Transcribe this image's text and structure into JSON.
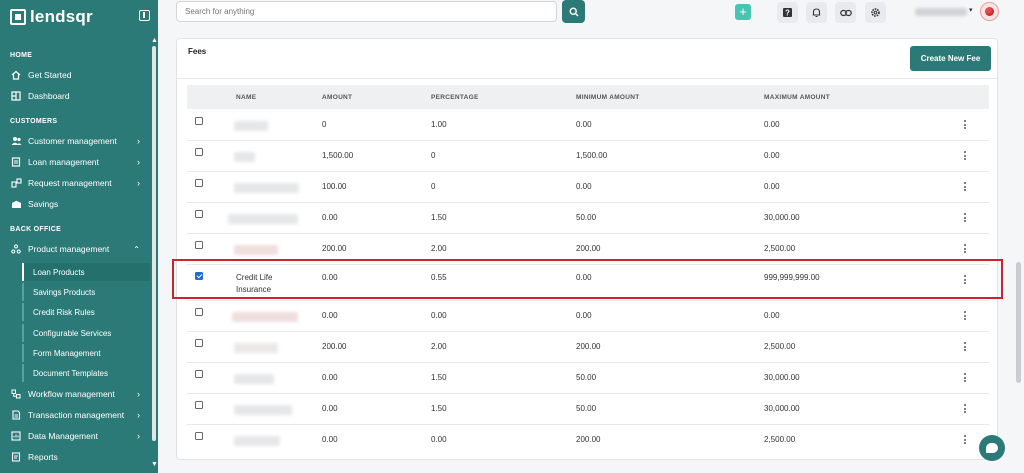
{
  "brand": {
    "name": "lendsqr"
  },
  "search": {
    "placeholder": "Search for anything"
  },
  "sidebar": {
    "sections": [
      {
        "title": "HOME"
      },
      {
        "title": "CUSTOMERS"
      },
      {
        "title": "BACK OFFICE"
      }
    ],
    "items": [
      {
        "label": "Get Started",
        "icon": "home-icon"
      },
      {
        "label": "Dashboard",
        "icon": "dashboard-icon"
      },
      {
        "label": "Customer management",
        "icon": "users-icon"
      },
      {
        "label": "Loan management",
        "icon": "loan-icon"
      },
      {
        "label": "Request management",
        "icon": "request-icon"
      },
      {
        "label": "Savings",
        "icon": "savings-icon"
      },
      {
        "label": "Product management",
        "icon": "product-icon"
      },
      {
        "label": "Workflow management",
        "icon": "workflow-icon"
      },
      {
        "label": "Transaction management",
        "icon": "transaction-icon"
      },
      {
        "label": "Data Management",
        "icon": "data-icon"
      },
      {
        "label": "Reports",
        "icon": "reports-icon"
      }
    ],
    "sub_items": [
      {
        "label": "Loan Products",
        "active": true
      },
      {
        "label": "Savings Products"
      },
      {
        "label": "Credit Risk Rules"
      },
      {
        "label": "Configurable Services"
      },
      {
        "label": "Form Management"
      },
      {
        "label": "Document Templates"
      }
    ]
  },
  "card": {
    "title": "Fees",
    "create_label": "Create New Fee"
  },
  "table": {
    "headers": [
      "NAME",
      "AMOUNT",
      "PERCENTAGE",
      "MINIMUM AMOUNT",
      "MAXIMUM AMOUNT"
    ],
    "rows": [
      {
        "name": "",
        "amount": "0",
        "percentage": "1.00",
        "min": "0.00",
        "max": "0.00",
        "checked": false
      },
      {
        "name": "",
        "amount": "1,500.00",
        "percentage": "0",
        "min": "1,500.00",
        "max": "0.00",
        "checked": false
      },
      {
        "name": "",
        "amount": "100.00",
        "percentage": "0",
        "min": "0.00",
        "max": "0.00",
        "checked": false
      },
      {
        "name": "",
        "amount": "0.00",
        "percentage": "1.50",
        "min": "50.00",
        "max": "30,000.00",
        "checked": false
      },
      {
        "name": "",
        "amount": "200.00",
        "percentage": "2.00",
        "min": "200.00",
        "max": "2,500.00",
        "checked": false
      },
      {
        "name_line1": "Credit Life",
        "name_line2": "Insurance",
        "amount": "0.00",
        "percentage": "0.55",
        "min": "0.00",
        "max": "999,999,999.00",
        "checked": true
      },
      {
        "name": "",
        "amount": "0.00",
        "percentage": "0.00",
        "min": "0.00",
        "max": "0.00",
        "checked": false
      },
      {
        "name": "",
        "amount": "200.00",
        "percentage": "2.00",
        "min": "200.00",
        "max": "2,500.00",
        "checked": false
      },
      {
        "name": "",
        "amount": "0.00",
        "percentage": "1.50",
        "min": "50.00",
        "max": "30,000.00",
        "checked": false
      },
      {
        "name": "",
        "amount": "0.00",
        "percentage": "1.50",
        "min": "50.00",
        "max": "30,000.00",
        "checked": false
      },
      {
        "name": "",
        "amount": "0.00",
        "percentage": "0.00",
        "min": "200.00",
        "max": "2,500.00",
        "checked": false
      }
    ]
  },
  "colors": {
    "brand": "#2b7a77",
    "accent": "#48c4b2",
    "highlight": "#c8262c"
  }
}
